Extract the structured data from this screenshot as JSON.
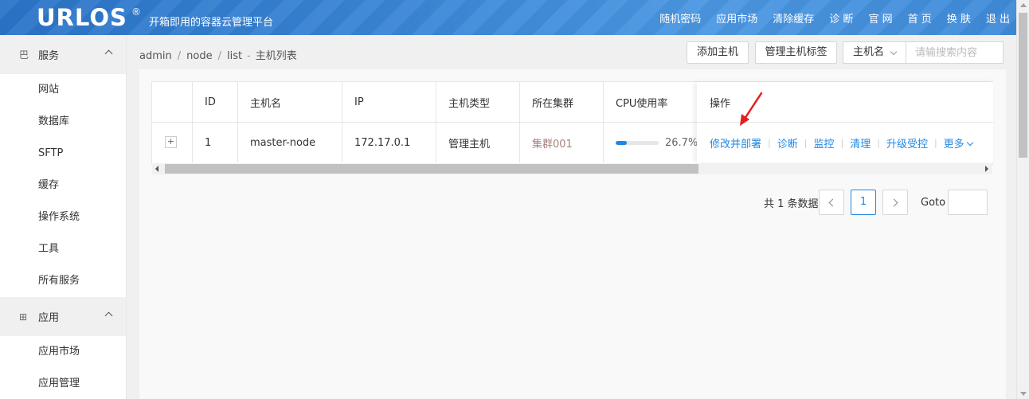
{
  "header": {
    "logo": "URLOS",
    "logo_mark": "®",
    "slogan": "开箱即用的容器云管理平台",
    "nav": [
      "随机密码",
      "应用市场",
      "清除缓存",
      "诊 断",
      "官 网",
      "首 页",
      "换 肤",
      "退 出"
    ]
  },
  "sidebar": {
    "groups": [
      {
        "icon": "巴",
        "label": "服务",
        "items": [
          "网站",
          "数据库",
          "SFTP",
          "缓存",
          "操作系统",
          "工具",
          "所有服务"
        ]
      },
      {
        "icon": "⊞",
        "label": "应用",
        "items": [
          "应用市场",
          "应用管理"
        ]
      }
    ]
  },
  "breadcrumb": {
    "parts": [
      "admin",
      "node",
      "list"
    ],
    "title": "主机列表"
  },
  "toolbar": {
    "add_host": "添加主机",
    "manage_tags": "管理主机标签",
    "search_field": "主机名",
    "search_placeholder": "请输搜索内容"
  },
  "table": {
    "headers": [
      "ID",
      "主机名",
      "IP",
      "主机类型",
      "所在集群",
      "CPU使用率",
      "操作"
    ],
    "row": {
      "expand": "+",
      "id": "1",
      "hostname": "master-node",
      "ip": "172.17.0.1",
      "type": "管理主机",
      "cluster": "集群001",
      "cpu": "26.7%",
      "cpu_fraction": 0.267
    },
    "actions": [
      "修改并部署",
      "诊断",
      "监控",
      "清理",
      "升级受控",
      "更多"
    ]
  },
  "pagination": {
    "total": "共 1 条数据",
    "current": "1",
    "goto_label": "Goto"
  },
  "colors": {
    "accent": "#1e88e5",
    "header": "#3a86d6",
    "annotation_arrow": "#e02020"
  }
}
